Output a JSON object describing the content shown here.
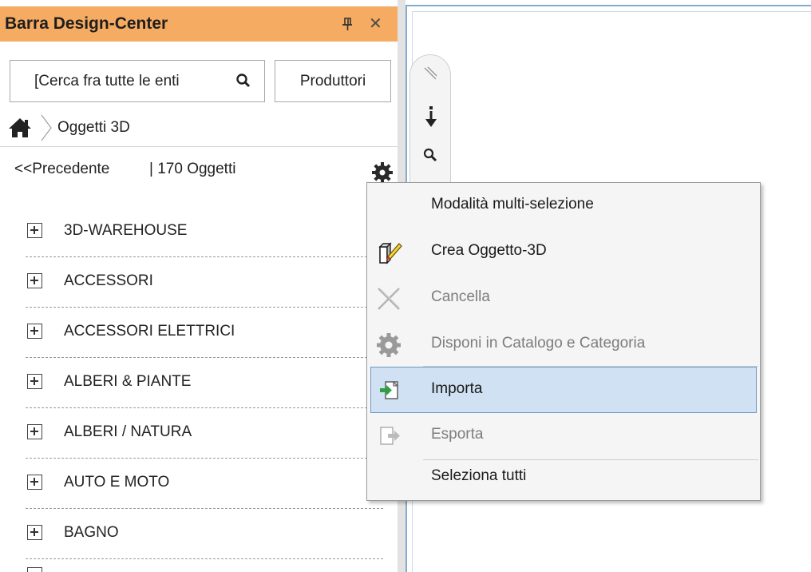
{
  "panel": {
    "title": "Barra Design-Center",
    "search_placeholder": "[Cerca fra tutte le enti",
    "producers_label": "Produttori",
    "breadcrumb_label": "Oggetti 3D",
    "prev_label": "<<Precedente",
    "count_label": "| 170 Oggetti",
    "tree_items": [
      {
        "label": "3D-WAREHOUSE"
      },
      {
        "label": "ACCESSORI"
      },
      {
        "label": "ACCESSORI ELETTRICI"
      },
      {
        "label": "ALBERI & PIANTE"
      },
      {
        "label": "ALBERI / NATURA"
      },
      {
        "label": "AUTO E MOTO"
      },
      {
        "label": "BAGNO"
      }
    ]
  },
  "context_menu": {
    "items": [
      {
        "label": "Modalità multi-selezione",
        "state": "enabled",
        "icon": "none"
      },
      {
        "label": "Crea Oggetto-3D",
        "state": "enabled",
        "icon": "pencil-object-icon"
      },
      {
        "label": "Cancella",
        "state": "disabled",
        "icon": "scissors-icon"
      },
      {
        "label": "Disponi in Catalogo e Categoria",
        "state": "disabled",
        "icon": "gear-icon"
      },
      {
        "label": "Importa",
        "state": "highlighted",
        "icon": "import-icon"
      },
      {
        "label": "Esporta",
        "state": "disabled",
        "icon": "export-icon"
      },
      {
        "label": "Seleziona tutti",
        "state": "enabled",
        "icon": "none"
      }
    ]
  },
  "colors": {
    "titlebar": "#f6ab62",
    "highlight": "#cfe1f3",
    "highlight_border": "#6f96c6",
    "frame_border": "#86aacd"
  }
}
